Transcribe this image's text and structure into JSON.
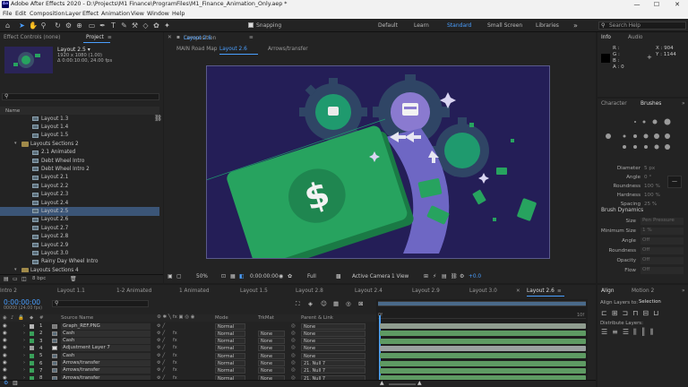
{
  "window": {
    "title": "Adobe After Effects 2020 - D:\\Projects\\M1 Finance\\ProgramFiles\\M1_Finance_Animation_Only.aep *",
    "app_badge": "Ae",
    "minimize": "—",
    "maximize": "☐",
    "close": "✕"
  },
  "menu": [
    "File",
    "Edit",
    "Composition",
    "Layer",
    "Effect",
    "Animation",
    "View",
    "Window",
    "Help"
  ],
  "toolbar": {
    "snapping": "Snapping",
    "workspaces": [
      "Default",
      "Learn",
      "Standard",
      "Small Screen",
      "Libraries"
    ],
    "active_workspace": "Standard",
    "search_placeholder": "Search Help"
  },
  "project": {
    "tabs": [
      "Effect Controls (none)",
      "Project"
    ],
    "active_tab": "Project",
    "comp_name": "Layout 2.5 ▾",
    "comp_info": [
      "1920 x 1080 (1.00)",
      "Δ 0:00:10:00, 24.00 fps"
    ],
    "column": "Name",
    "items": [
      {
        "label": "Layout 1.3",
        "type": "comp",
        "indent": 3
      },
      {
        "label": "Layout 1.4",
        "type": "comp",
        "indent": 3
      },
      {
        "label": "Layout 1.5",
        "type": "comp",
        "indent": 3
      },
      {
        "label": "Layouts Sections 2",
        "type": "folder",
        "indent": 2
      },
      {
        "label": "2.1 Animated",
        "type": "comp",
        "indent": 3
      },
      {
        "label": "Debt Wheel Intro",
        "type": "comp",
        "indent": 3
      },
      {
        "label": "Debt Wheel Intro 2",
        "type": "comp",
        "indent": 3
      },
      {
        "label": "Layout 2.1",
        "type": "comp",
        "indent": 3
      },
      {
        "label": "Layout 2.2",
        "type": "comp",
        "indent": 3
      },
      {
        "label": "Layout 2.3",
        "type": "comp",
        "indent": 3
      },
      {
        "label": "Layout 2.4",
        "type": "comp",
        "indent": 3
      },
      {
        "label": "Layout 2.5",
        "type": "comp",
        "indent": 3,
        "selected": true
      },
      {
        "label": "Layout 2.6",
        "type": "comp",
        "indent": 3
      },
      {
        "label": "Layout 2.7",
        "type": "comp",
        "indent": 3
      },
      {
        "label": "Layout 2.8",
        "type": "comp",
        "indent": 3
      },
      {
        "label": "Layout 2.9",
        "type": "comp",
        "indent": 3
      },
      {
        "label": "Layout 3.0",
        "type": "comp",
        "indent": 3
      },
      {
        "label": "Rainy Day Wheel Intro",
        "type": "comp",
        "indent": 3
      },
      {
        "label": "Layouts Sections 4",
        "type": "folder",
        "indent": 2
      }
    ],
    "bpc": "8 bpc"
  },
  "composition": {
    "tab_label": "Composition",
    "tab_comp": "Layout 2.6",
    "breadcrumbs": [
      "MAIN Road Map",
      "Layout 2.6",
      "Arrows/transfer"
    ],
    "active_breadcrumb": "Layout 2.6",
    "zoom": "50%",
    "timecode": "0:00:00:00",
    "resolution": "Full",
    "camera": "Active Camera",
    "views": "1 View",
    "exposure": "+0.0",
    "dollar": "$"
  },
  "info": {
    "tabs": [
      "Info",
      "Audio"
    ],
    "labels": [
      "R :",
      "G :",
      "B :",
      "A : 0"
    ],
    "x": "X : 904",
    "y": "Y : 1144"
  },
  "character": {
    "tabs": [
      "Character",
      "Brushes"
    ],
    "active_tab": "Brushes",
    "fields": [
      {
        "label": "Diameter",
        "value": "5 px"
      },
      {
        "label": "Angle",
        "value": "0 °"
      },
      {
        "label": "Roundness",
        "value": "100 %"
      },
      {
        "label": "Hardness",
        "value": "100 %"
      },
      {
        "label": "Spacing",
        "value": "25 %"
      }
    ],
    "dynamics_title": "Brush Dynamics",
    "dynamics": [
      {
        "label": "Size",
        "value": "Pen Pressure"
      },
      {
        "label": "Minimum Size",
        "value": "1 %"
      },
      {
        "label": "Angle",
        "value": "Off"
      },
      {
        "label": "Roundness",
        "value": "Off"
      },
      {
        "label": "Opacity",
        "value": "Off"
      },
      {
        "label": "Flow",
        "value": "Off"
      }
    ]
  },
  "timeline": {
    "tabs": [
      "Intro 2",
      "Layout 1.1",
      "1-2 Animated",
      "1 Animated",
      "Layout 1.5",
      "Layout 2.8",
      "Layout 2.4",
      "Layout 2.9",
      "Layout 3.0",
      "Layout 2.6"
    ],
    "active_tab": "Layout 2.6",
    "timecode": "0:00:00:00",
    "frame_info": "00000 (24.00 fps)",
    "headers": {
      "source": "Source Name",
      "mode": "Mode",
      "trkmat": "TrkMat",
      "parent": "Parent & Link"
    },
    "layers": [
      {
        "num": "1",
        "name": "Graph_REF.PNG",
        "mode": "Normal",
        "trkmat": "",
        "parent": "None",
        "color": "#b5b5b5",
        "bar": "#8f9c8f",
        "type": "img"
      },
      {
        "num": "2",
        "name": "Cash",
        "mode": "Normal",
        "trkmat": "None",
        "parent": "None",
        "color": "#3aa05a",
        "bar": "#5e9a63",
        "type": "comp"
      },
      {
        "num": "3",
        "name": "Cash",
        "mode": "Normal",
        "trkmat": "None",
        "parent": "None",
        "color": "#3aa05a",
        "bar": "#5e9a63",
        "type": "comp"
      },
      {
        "num": "4",
        "name": "Adjustment Layer 7",
        "mode": "Normal",
        "trkmat": "None",
        "parent": "None",
        "color": "#a0a0a0",
        "bar": "#9aa0a0",
        "type": "adj"
      },
      {
        "num": "5",
        "name": "Cash",
        "mode": "Normal",
        "trkmat": "None",
        "parent": "None",
        "color": "#3aa05a",
        "bar": "#5e9a63",
        "type": "comp"
      },
      {
        "num": "6",
        "name": "Arrows/transfer",
        "mode": "Normal",
        "trkmat": "None",
        "parent": "21. Null 7",
        "color": "#3aa05a",
        "bar": "#5e9a63",
        "type": "comp"
      },
      {
        "num": "7",
        "name": "Arrows/transfer",
        "mode": "Normal",
        "trkmat": "None",
        "parent": "21. Null 7",
        "color": "#3aa05a",
        "bar": "#5e9a63",
        "type": "comp"
      },
      {
        "num": "8",
        "name": "Arrows/transfer",
        "mode": "Normal",
        "trkmat": "None",
        "parent": "21. Null 7",
        "color": "#3aa05a",
        "bar": "#5e9a63",
        "type": "comp"
      }
    ],
    "ruler": [
      "0f",
      "10f"
    ]
  },
  "align": {
    "tabs": [
      "Align",
      "Motion 2"
    ],
    "align_to_label": "Align Layers to:",
    "align_to": "Selection",
    "distribute_label": "Distribute Layers:"
  },
  "colors": {
    "comp_bg": "#241e57",
    "teal": "#1a9a6a",
    "bill": "#27a35f",
    "bill_dark": "#1a7a45",
    "gear": "#3a4f6a",
    "accent": "#3a88d8",
    "label_green": "#3aa05a",
    "timeline_bar": "#5e9a63"
  }
}
